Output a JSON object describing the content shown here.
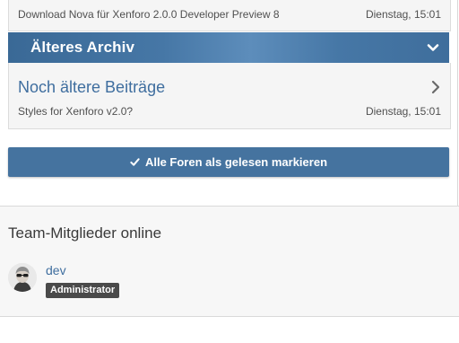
{
  "previous_node": {
    "latest_post": "Download Nova für Xenforo 2.0.0 Developer Preview 8",
    "latest_time": "Dienstag, 15:01"
  },
  "category": {
    "title": "Älteres Archiv",
    "toggle_icon": "chevron-down-icon"
  },
  "node": {
    "title": "Noch ältere Beiträge",
    "latest_post": "Styles for Xenforo v2.0?",
    "latest_time": "Dienstag, 15:01",
    "arrow_icon": "chevron-right-icon"
  },
  "mark_read": {
    "icon": "check-icon",
    "label": "Alle Foren als gelesen markieren",
    "color": "#45739f"
  },
  "sidebar": {
    "title": "Team-Mitglieder online",
    "members": [
      {
        "name": "dev",
        "role": "Administrator"
      }
    ]
  },
  "colors": {
    "link": "#3f6e9f",
    "header": "#4677a6",
    "badge": "#4a4a4a"
  }
}
